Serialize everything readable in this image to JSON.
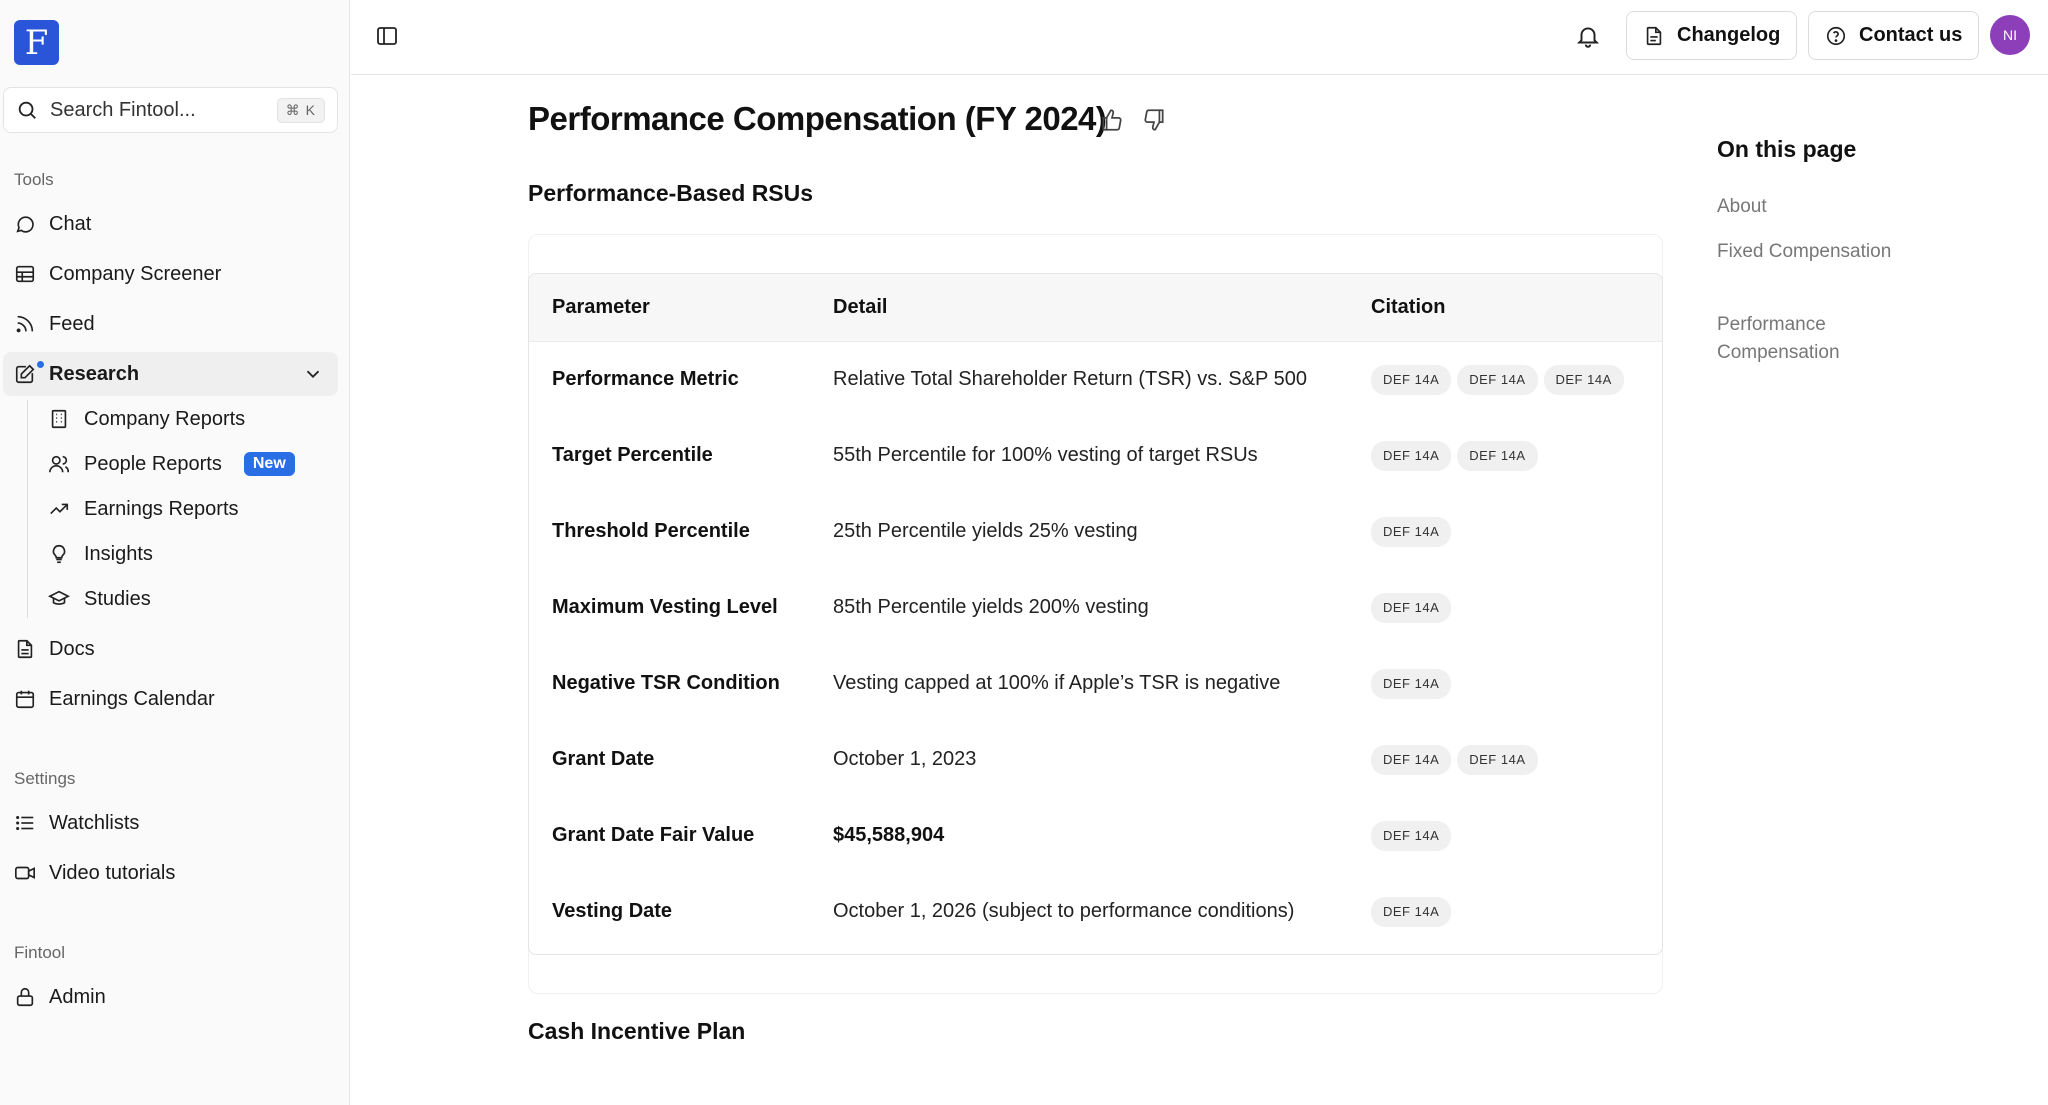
{
  "sidebar": {
    "logo_letter": "F",
    "search": {
      "placeholder": "Search Fintool...",
      "shortcut": "⌘ K"
    },
    "tools_label": "Tools",
    "items": {
      "chat": "Chat",
      "company_screener": "Company Screener",
      "feed": "Feed",
      "research": "Research",
      "docs": "Docs",
      "earnings_calendar": "Earnings Calendar"
    },
    "research_sub": {
      "company_reports": "Company Reports",
      "people_reports": "People Reports",
      "people_reports_badge": "New",
      "earnings_reports": "Earnings Reports",
      "insights": "Insights",
      "studies": "Studies"
    },
    "settings_label": "Settings",
    "settings_items": {
      "watchlists": "Watchlists",
      "video_tutorials": "Video tutorials"
    },
    "fintool_label": "Fintool",
    "fintool_items": {
      "admin": "Admin"
    }
  },
  "topbar": {
    "changelog": "Changelog",
    "contact": "Contact us",
    "avatar_initials": "NI"
  },
  "main": {
    "title": "Performance Compensation (FY 2024)",
    "section1": "Performance-Based RSUs",
    "section2": "Cash Incentive Plan",
    "table": {
      "headers": {
        "parameter": "Parameter",
        "detail": "Detail",
        "citation": "Citation"
      },
      "rows": [
        {
          "param": "Performance Metric",
          "detail": "Relative Total Shareholder Return (TSR) vs. S&P 500",
          "c1": "DEF 14A",
          "c2": "DEF 14A",
          "c3": "DEF 14A"
        },
        {
          "param": "Target Percentile",
          "detail": "55th Percentile for 100% vesting of target RSUs",
          "c1": "DEF 14A",
          "c2": "DEF 14A"
        },
        {
          "param": "Threshold Percentile",
          "detail": "25th Percentile yields 25% vesting",
          "c1": "DEF 14A"
        },
        {
          "param": "Maximum Vesting Level",
          "detail": "85th Percentile yields 200% vesting",
          "c1": "DEF 14A"
        },
        {
          "param": "Negative TSR Condition",
          "detail": "Vesting capped at 100% if Apple’s TSR is negative",
          "c1": "DEF 14A"
        },
        {
          "param": "Grant Date",
          "detail": "October 1, 2023",
          "c1": "DEF 14A",
          "c2": "DEF 14A"
        },
        {
          "param": "Grant Date Fair Value",
          "detail": "$45,588,904",
          "c1": "DEF 14A"
        },
        {
          "param": "Vesting Date",
          "detail": "October 1, 2026 (subject to performance conditions)",
          "c1": "DEF 14A"
        }
      ]
    }
  },
  "toc": {
    "title": "On this page",
    "links": {
      "about": "About",
      "fixed": "Fixed Compensation",
      "performance": "Performance Compensation"
    }
  },
  "colors": {
    "accent": "#2a6ee6",
    "logo": "#2a55d9",
    "avatar": "#8c3fb8"
  }
}
